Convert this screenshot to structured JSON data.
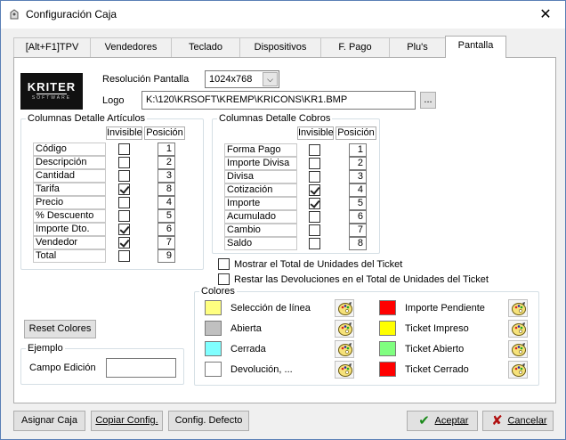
{
  "window": {
    "title": "Configuración Caja",
    "close_glyph": "✕"
  },
  "tabs": [
    {
      "label": "[Alt+F1]TPV"
    },
    {
      "label": "Vendedores"
    },
    {
      "label": "Teclado"
    },
    {
      "label": "Dispositivos"
    },
    {
      "label": "F. Pago"
    },
    {
      "label": "Plu's"
    },
    {
      "label": "Pantalla",
      "active": true
    }
  ],
  "logo": {
    "line1": "KRITER",
    "line2": "SOFTWARE"
  },
  "resolution": {
    "label": "Resolución Pantalla",
    "value": "1024x768",
    "dropdown_glyph": "⌵"
  },
  "logo_field": {
    "label": "Logo",
    "value": "K:\\120\\KRSOFT\\KREMP\\KRICONS\\KR1.BMP",
    "browse_label": "..."
  },
  "articulos": {
    "title": "Columnas Detalle Artículos",
    "header_invisible": "Invisible",
    "header_posicion": "Posición",
    "rows": [
      {
        "label": "Código",
        "invisible": false,
        "pos": "1"
      },
      {
        "label": "Descripción",
        "invisible": false,
        "pos": "2"
      },
      {
        "label": "Cantidad",
        "invisible": false,
        "pos": "3"
      },
      {
        "label": "Tarifa",
        "invisible": true,
        "pos": "8"
      },
      {
        "label": "Precio",
        "invisible": false,
        "pos": "4"
      },
      {
        "label": "% Descuento",
        "invisible": false,
        "pos": "5"
      },
      {
        "label": "Importe Dto.",
        "invisible": true,
        "pos": "6"
      },
      {
        "label": "Vendedor",
        "invisible": true,
        "pos": "7"
      },
      {
        "label": "Total",
        "invisible": false,
        "pos": "9"
      }
    ]
  },
  "cobros": {
    "title": "Columnas Detalle Cobros",
    "header_invisible": "Invisible",
    "header_posicion": "Posición",
    "rows": [
      {
        "label": "Forma Pago",
        "invisible": false,
        "pos": "1"
      },
      {
        "label": "Importe Divisa",
        "invisible": false,
        "pos": "2"
      },
      {
        "label": "Divisa",
        "invisible": false,
        "pos": "3"
      },
      {
        "label": "Cotización",
        "invisible": true,
        "pos": "4"
      },
      {
        "label": "Importe",
        "invisible": true,
        "pos": "5"
      },
      {
        "label": "Acumulado",
        "invisible": false,
        "pos": "6"
      },
      {
        "label": "Cambio",
        "invisible": false,
        "pos": "7"
      },
      {
        "label": "Saldo",
        "invisible": false,
        "pos": "8"
      }
    ]
  },
  "options": {
    "mostrar_total": {
      "label": "Mostrar el Total de Unidades del Ticket",
      "checked": false
    },
    "restar_devoluciones": {
      "label": "Restar las Devoluciones en el Total de Unidades del Ticket",
      "checked": false
    }
  },
  "colores": {
    "title": "Colores",
    "left": [
      {
        "label": "Selección de línea",
        "color": "#ffff80"
      },
      {
        "label": "Abierta",
        "color": "#c0c0c0"
      },
      {
        "label": "Cerrada",
        "color": "#80ffff"
      },
      {
        "label": "Devolución, ...",
        "color": "#ffffff"
      }
    ],
    "right": [
      {
        "label": "Importe Pendiente",
        "color": "#ff0000"
      },
      {
        "label": "Ticket Impreso",
        "color": "#ffff00"
      },
      {
        "label": "Ticket Abierto",
        "color": "#80ff80"
      },
      {
        "label": "Ticket Cerrado",
        "color": "#ff0000"
      }
    ]
  },
  "reset_colores": {
    "label": "Reset Colores"
  },
  "ejemplo": {
    "title": "Ejemplo",
    "field_label": "Campo Edición",
    "field_value": ""
  },
  "footer": {
    "asignar": "Asignar Caja",
    "copiar": "Copiar Config.",
    "config_defecto": "Config. Defecto",
    "aceptar": "Aceptar",
    "cancelar": "Cancelar",
    "aceptar_glyph": "✔",
    "cancelar_glyph": "✘"
  },
  "colors": {
    "accept": "#1a8a1a",
    "cancel": "#b01010",
    "window_border": "#5a7fb5"
  }
}
